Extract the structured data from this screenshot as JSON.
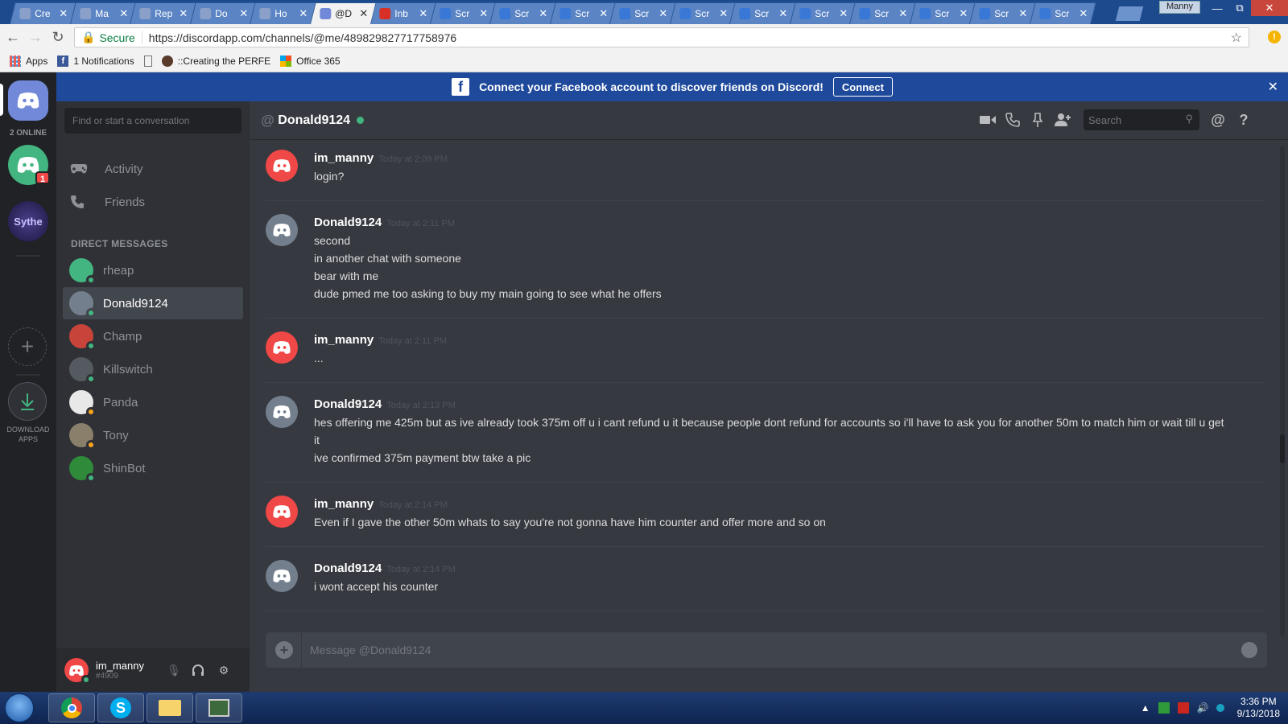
{
  "browser": {
    "tabs": [
      {
        "label": "Cre",
        "color": "#8aa0c8"
      },
      {
        "label": "Ma",
        "color": "#8aa0c8"
      },
      {
        "label": "Rep",
        "color": "#8aa0c8"
      },
      {
        "label": "Do",
        "color": "#8aa0c8"
      },
      {
        "label": "Ho",
        "color": "#8aa0c8"
      },
      {
        "label": "@D",
        "color": "#7289da",
        "active": true
      },
      {
        "label": "Inb",
        "color": "#d93025"
      },
      {
        "label": "Scr",
        "color": "#3a78d8"
      },
      {
        "label": "Scr",
        "color": "#3a78d8"
      },
      {
        "label": "Scr",
        "color": "#3a78d8"
      },
      {
        "label": "Scr",
        "color": "#3a78d8"
      },
      {
        "label": "Scr",
        "color": "#3a78d8"
      },
      {
        "label": "Scr",
        "color": "#3a78d8"
      },
      {
        "label": "Scr",
        "color": "#3a78d8"
      },
      {
        "label": "Scr",
        "color": "#3a78d8"
      },
      {
        "label": "Scr",
        "color": "#3a78d8"
      },
      {
        "label": "Scr",
        "color": "#3a78d8"
      },
      {
        "label": "Scr",
        "color": "#3a78d8"
      }
    ],
    "profile": "Manny",
    "secure_label": "Secure",
    "url": "https://discordapp.com/channels/@me/489829827717758976",
    "bookmarks": {
      "apps": "Apps",
      "notifications": "1 Notifications",
      "creating": "::Creating the PERFE",
      "office": "Office 365"
    }
  },
  "rail": {
    "online_label": "2 ONLINE",
    "mention_count": "1",
    "server_label": "Sythe",
    "download_label": "DOWNLOAD APPS"
  },
  "facebook_bar": {
    "text": "Connect your Facebook account to discover friends on Discord!",
    "button": "Connect"
  },
  "dm_panel": {
    "search_placeholder": "Find or start a conversation",
    "nav": [
      {
        "label": "Activity",
        "icon": "gamepad-icon"
      },
      {
        "label": "Friends",
        "icon": "friends-icon"
      }
    ],
    "heading": "DIRECT MESSAGES",
    "items": [
      {
        "name": "rheap",
        "status": "#43b581",
        "avatar": "#43b581"
      },
      {
        "name": "Donald9124",
        "status": "#43b581",
        "avatar": "#747f8d",
        "active": true
      },
      {
        "name": "Champ",
        "status": "#43b581",
        "avatar": "#c8443a"
      },
      {
        "name": "Killswitch",
        "status": "#43b581",
        "avatar": "#555a60"
      },
      {
        "name": "Panda",
        "status": "#faa61a",
        "avatar": "#e8e8e8"
      },
      {
        "name": "Tony",
        "status": "#faa61a",
        "avatar": "#8a7f6a"
      },
      {
        "name": "ShinBot",
        "status": "#43b581",
        "avatar": "#2f8a3a"
      }
    ]
  },
  "user_panel": {
    "name": "im_manny",
    "tag": "#4909"
  },
  "chat": {
    "title": "Donald9124",
    "search_placeholder": "Search",
    "composer_placeholder": "Message @Donald9124",
    "messages": [
      {
        "author": "im_manny",
        "time": "Today at 2:09 PM",
        "avatar": "#f04747",
        "lines": [
          "login?"
        ]
      },
      {
        "author": "Donald9124",
        "time": "Today at 2:11 PM",
        "avatar": "#747f8d",
        "lines": [
          "second",
          "in another chat with someone",
          "bear with me",
          "dude pmed me too asking to buy my main going to see what he offers"
        ]
      },
      {
        "author": "im_manny",
        "time": "Today at 2:11 PM",
        "avatar": "#f04747",
        "lines": [
          "..."
        ]
      },
      {
        "author": "Donald9124",
        "time": "Today at 2:13 PM",
        "avatar": "#747f8d",
        "lines": [
          "hes offering me 425m but as ive already took 375m off u i cant refund u it because people dont refund for accounts so i'll have to ask you for another 50m to match him or wait till u get",
          "it",
          "ive confirmed 375m payment btw take a pic"
        ]
      },
      {
        "author": "im_manny",
        "time": "Today at 2:14 PM",
        "avatar": "#f04747",
        "lines": [
          "Even if I gave the other 50m whats to say you're not gonna have him counter and offer more and so on"
        ]
      },
      {
        "author": "Donald9124",
        "time": "Today at 2:14 PM",
        "avatar": "#747f8d",
        "lines": [
          "i wont accept his counter"
        ]
      }
    ]
  },
  "taskbar": {
    "time": "3:36 PM",
    "date": "9/13/2018"
  },
  "colors": {
    "blurple": "#7289da",
    "online": "#43b581",
    "idle": "#faa61a",
    "danger": "#f04747"
  }
}
